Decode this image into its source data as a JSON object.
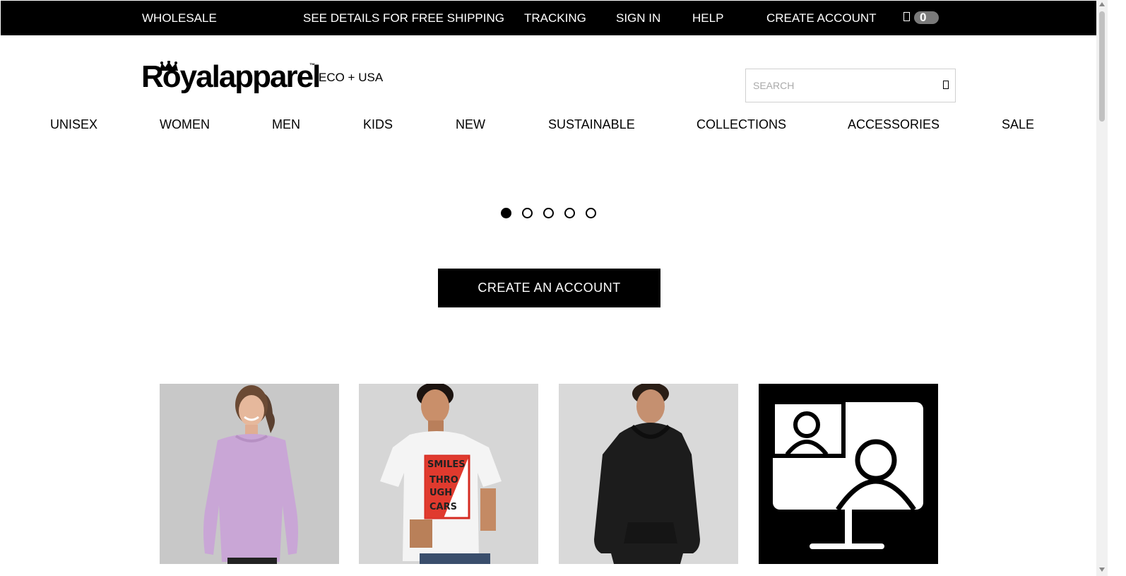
{
  "topbar": {
    "wholesale": "WHOLESALE",
    "shipping": "SEE DETAILS FOR FREE SHIPPING",
    "tracking": "TRACKING",
    "sign_in": "SIGN IN",
    "help": "HELP",
    "create_account": "CREATE ACCOUNT",
    "cart_count": "0",
    "cart_icon": "cart-icon"
  },
  "brand": {
    "logo_text": "Royalapparel",
    "tm": "™",
    "subtitle": "ECO + USA"
  },
  "search": {
    "placeholder": "SEARCH",
    "icon": "search-icon"
  },
  "nav": {
    "items": [
      {
        "label": "UNISEX"
      },
      {
        "label": "WOMEN"
      },
      {
        "label": "MEN"
      },
      {
        "label": "KIDS"
      },
      {
        "label": "NEW"
      },
      {
        "label": "SUSTAINABLE"
      },
      {
        "label": "COLLECTIONS"
      },
      {
        "label": "ACCESSORIES"
      },
      {
        "label": "SALE"
      }
    ]
  },
  "carousel": {
    "slide_count": 5,
    "active_index": 0
  },
  "cta": {
    "label": "CREATE AN ACCOUNT"
  },
  "products": [
    {
      "image": "woman-lavender-sweatshirt",
      "color": "#c8a5d4"
    },
    {
      "image": "man-graphic-tee",
      "graphic_lines": [
        "SMILES",
        "THRO",
        "UGH",
        "CARS"
      ],
      "accent": "#e03a2e"
    },
    {
      "image": "man-black-hoodie",
      "color": "#1c1c1c"
    },
    {
      "image": "video-call-icon"
    }
  ]
}
